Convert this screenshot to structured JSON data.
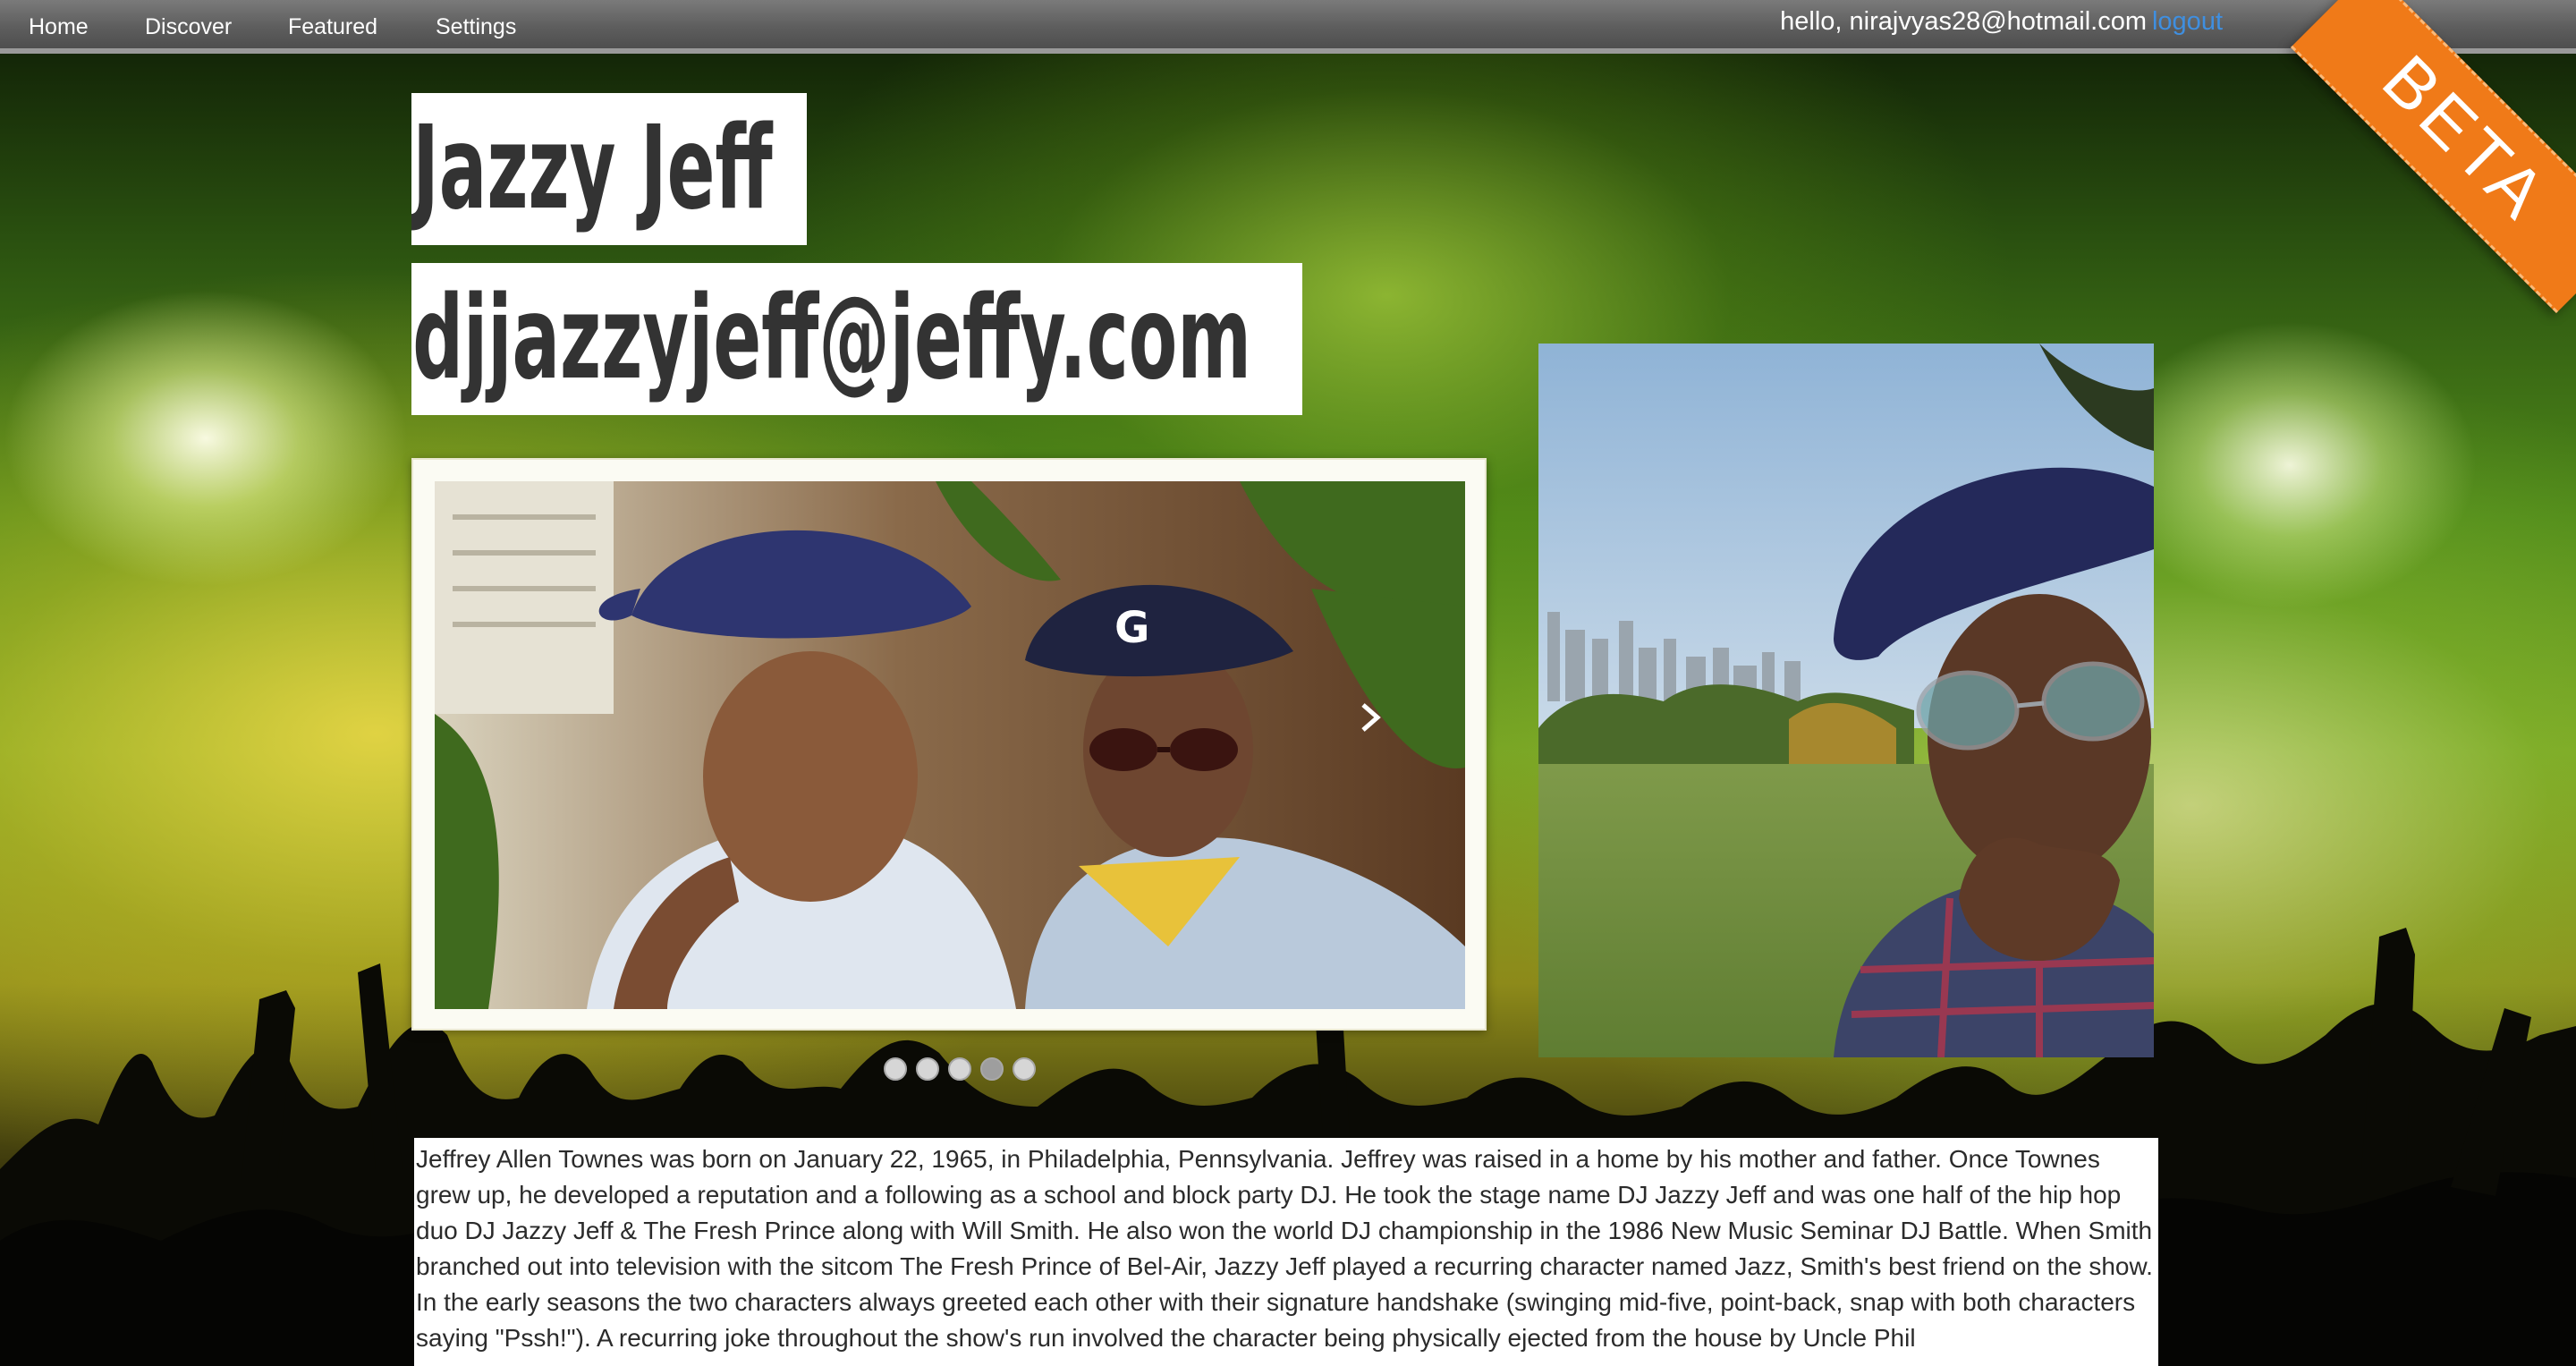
{
  "nav": {
    "items": [
      {
        "label": "Home"
      },
      {
        "label": "Discover"
      },
      {
        "label": "Featured"
      },
      {
        "label": "Settings"
      }
    ],
    "greeting": "hello, nirajvyas28@hotmail.com",
    "logout_label": "logout"
  },
  "ribbon": {
    "label": "BETA",
    "color": "#f07a18"
  },
  "artist": {
    "name": "Jazzy Jeff",
    "email": "djjazzyjeff@jeffy.com"
  },
  "slider": {
    "slide_count": 5,
    "active_index": 3,
    "next_icon": "chevron-right-icon"
  },
  "bio": {
    "text": "Jeffrey Allen Townes was born on January 22, 1965, in Philadelphia, Pennsylvania. Jeffrey was raised in a home by his mother and father. Once Townes grew up, he developed a reputation and a following as a school and block party DJ. He took the stage name DJ Jazzy Jeff and was one half of the hip hop duo DJ Jazzy Jeff & The Fresh Prince along with Will Smith. He also won the world DJ championship in the 1986 New Music Seminar DJ Battle. When Smith branched out into television with the sitcom The Fresh Prince of Bel-Air, Jazzy Jeff played a recurring character named Jazz, Smith's best friend on the show. In the early seasons the two characters always greeted each other with their signature handshake (swinging mid-five, point-back, snap with both characters saying \"Pssh!\"). A recurring joke throughout the show's run involved the character being physically ejected from the house by Uncle Phil"
  },
  "colors": {
    "nav_background": "#5e5e5e",
    "logout_link": "#3f8fe0",
    "title_text": "#333333"
  }
}
